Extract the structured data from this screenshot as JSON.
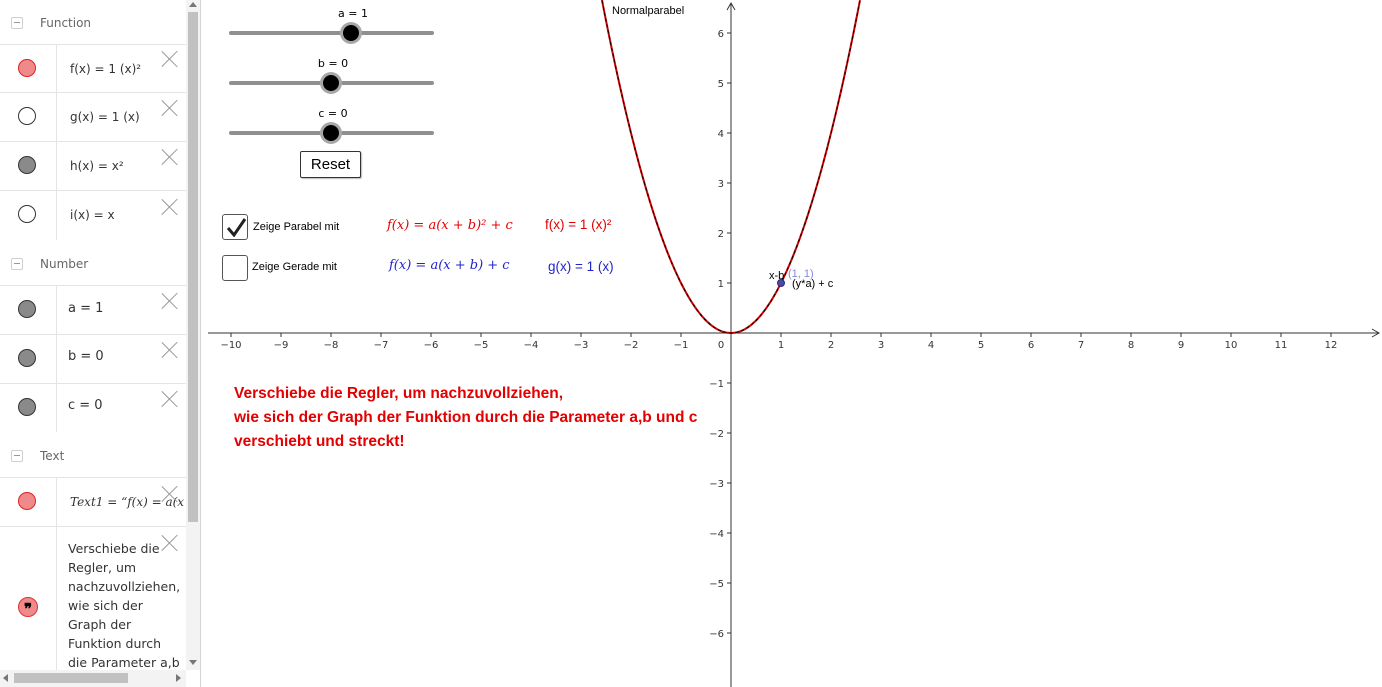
{
  "algebra": {
    "categories": {
      "function": "Function",
      "number": "Number",
      "text": "Text"
    },
    "functions": [
      {
        "expr": "f(x) = 1 (x)²",
        "color": "#f08a8a",
        "stroke": "#d22"
      },
      {
        "expr": "g(x) = 1 (x)",
        "color": "#ffffff",
        "stroke": "#333"
      },
      {
        "expr": "h(x) = x²",
        "color": "#8a8a8a",
        "stroke": "#333"
      },
      {
        "expr": "i(x) = x",
        "color": "#ffffff",
        "stroke": "#333"
      }
    ],
    "numbers": [
      {
        "expr": "a = 1",
        "color": "#8a8a8a"
      },
      {
        "expr": "b = 0",
        "color": "#8a8a8a"
      },
      {
        "expr": "c = 0",
        "color": "#8a8a8a"
      }
    ],
    "texts": [
      {
        "expr": "Text1 = “f(x) = a(x",
        "color": "#f08a8a"
      },
      {
        "expr": "Verschiebe die Regler, um nachzuvollziehen, wie sich der Graph der Funktion durch die Parameter a,b und c verschiebt",
        "icon": "❞"
      }
    ]
  },
  "sliders": [
    {
      "label": "a = 1",
      "value": 1,
      "min": -5,
      "max": 5
    },
    {
      "label": "b = 0",
      "value": 0,
      "min": -5,
      "max": 5
    },
    {
      "label": "c = 0",
      "value": 0,
      "min": -5,
      "max": 5
    }
  ],
  "reset_label": "Reset",
  "checkboxes": [
    {
      "label": "Zeige Parabel mit",
      "checked": true
    },
    {
      "label": "Zeige Gerade mit",
      "checked": false
    }
  ],
  "formulas": {
    "parabola_general": "f(x) = a(x + b)² + c",
    "parabola_value": "f(x) = 1 (x)²",
    "line_general": "f(x) = a(x + b) + c",
    "line_value": "g(x) = 1 (x)",
    "parabola_color": "#e30000",
    "line_color": "#2222cc"
  },
  "instruction": {
    "line1": "Verschiebe die Regler, um nachzuvollziehen,",
    "line2": "wie sich der Graph der Funktion durch die Parameter a,b und c",
    "line3": "verschiebt und streckt!"
  },
  "graph": {
    "curve_label": "Normalparabel",
    "point_label": "(1, 1)",
    "x_label": "x-b",
    "y_label": "(y*a) + c",
    "x_ticks": [
      -10,
      -9,
      -8,
      -7,
      -6,
      -5,
      -4,
      -3,
      -2,
      -1,
      0,
      1,
      2,
      3,
      4,
      5,
      6,
      7,
      8,
      9,
      10,
      11,
      12
    ],
    "y_ticks": [
      -6,
      -5,
      -4,
      -3,
      -2,
      -1,
      1,
      2,
      3,
      4,
      5,
      6
    ],
    "parabola_color": "#cc0000",
    "point_color": "#4a4aa0"
  }
}
